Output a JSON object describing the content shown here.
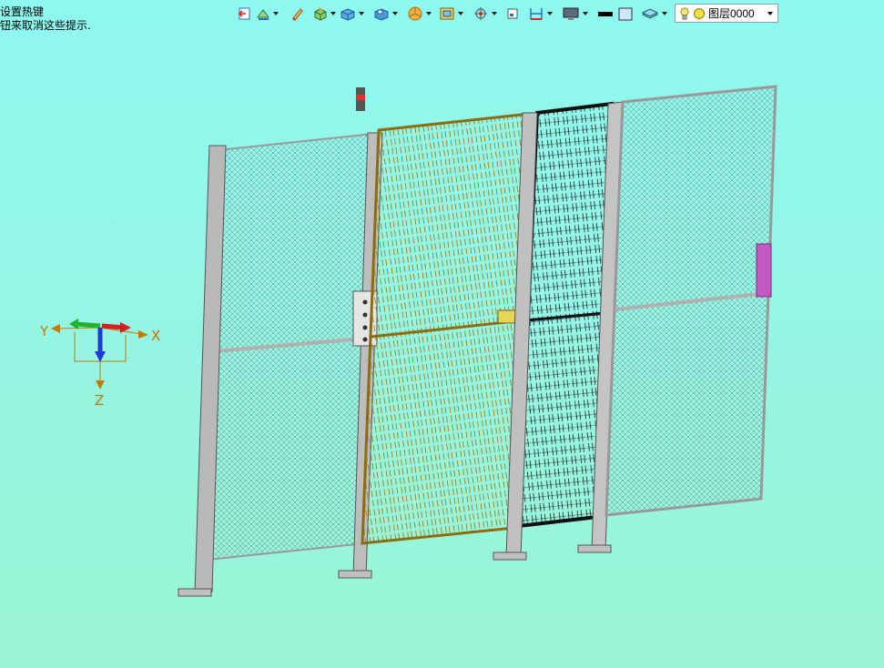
{
  "hint": {
    "line1": "设置热键",
    "line2": "钮来取消这些提示."
  },
  "toolbar": {
    "buttons": [
      {
        "name": "return-icon",
        "dropdown": false
      },
      {
        "name": "sketch-icon",
        "dropdown": true
      },
      {
        "name": "pencil-icon",
        "dropdown": false
      },
      {
        "name": "extrude-icon",
        "dropdown": true
      },
      {
        "name": "solid-box-icon",
        "dropdown": true
      },
      {
        "name": "shell-icon",
        "dropdown": true
      },
      {
        "name": "pie-icon",
        "dropdown": true
      },
      {
        "name": "view-box-icon",
        "dropdown": true
      },
      {
        "name": "target-icon",
        "dropdown": true
      },
      {
        "name": "small-frame-icon",
        "dropdown": false
      },
      {
        "name": "dimension-icon",
        "dropdown": true
      },
      {
        "name": "monitor-icon",
        "dropdown": true
      },
      {
        "name": "line-color-icon",
        "dropdown": false
      },
      {
        "name": "fill-color-icon",
        "dropdown": false
      },
      {
        "name": "layer-stack-icon",
        "dropdown": true
      }
    ],
    "layer": {
      "value": "图层0000"
    }
  },
  "triad": {
    "x_label": "X",
    "y_label": "Y",
    "z_label": "Z"
  },
  "colors": {
    "background": "#94f6e6",
    "frame": "#a8a8a8",
    "gate": "#b8962a",
    "dark_frame": "#111111",
    "handle": "#c458c4",
    "axis_label": "#c27a00"
  }
}
